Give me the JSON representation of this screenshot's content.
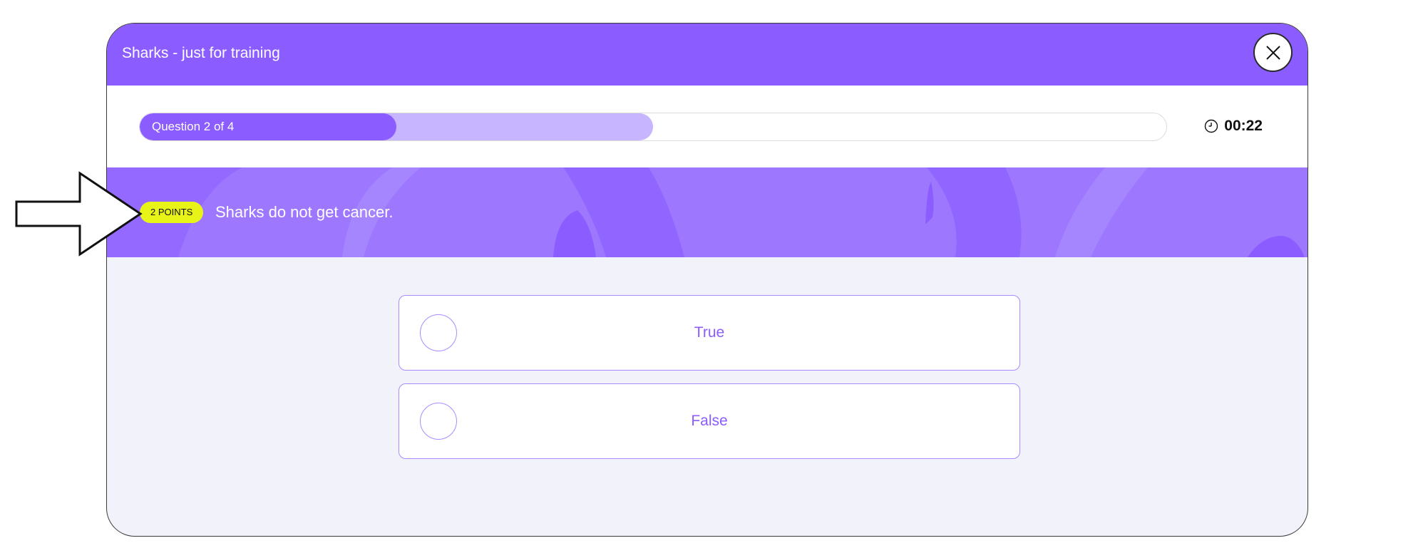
{
  "quiz": {
    "title": "Sharks - just for training",
    "close_icon": "close-icon"
  },
  "progress": {
    "label": "Question 2 of 4",
    "current": 2,
    "total": 4,
    "fill_fraction": 0.25,
    "secondary_fraction": 0.5
  },
  "timer": {
    "icon": "clock-icon",
    "value": "00:22"
  },
  "question": {
    "points": "2 POINTS",
    "text": "Sharks do not get cancer."
  },
  "options": [
    {
      "label": "True"
    },
    {
      "label": "False"
    }
  ],
  "colors": {
    "brand": "#8b5cff",
    "band": "#9d78ff",
    "progress_secondary": "#c7b5ff",
    "badge": "#e8f318",
    "option_border": "#a98bff",
    "background": "#f2f2fa"
  }
}
